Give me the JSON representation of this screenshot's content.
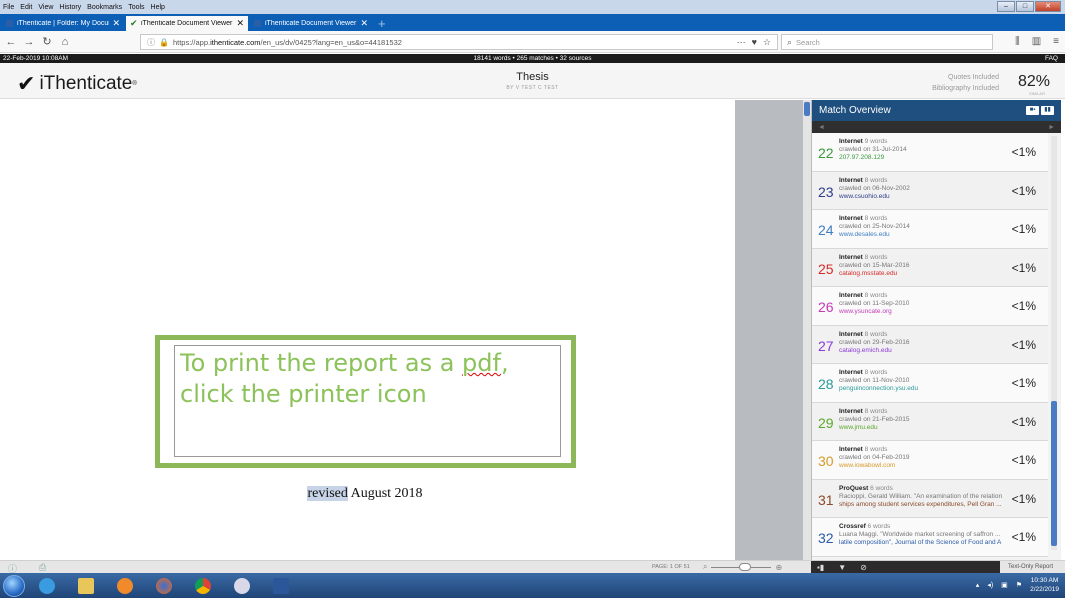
{
  "menubar": {
    "items": [
      "File",
      "Edit",
      "View",
      "History",
      "Bookmarks",
      "Tools",
      "Help"
    ],
    "underline": [
      "F",
      "E",
      "V",
      "s",
      "B",
      "T",
      "H"
    ]
  },
  "tabs": [
    {
      "label": "iThenticate | Folder: My Docum",
      "active": false
    },
    {
      "label": "iThenticate Document Viewer",
      "active": true
    },
    {
      "label": "iThenticate Document Viewer",
      "active": false
    }
  ],
  "url": {
    "prefix": "https://app.",
    "domain": "ithenticate.com",
    "path": "/en_us/dv/0425?lang=en_us&o=44181532"
  },
  "search": {
    "placeholder": "Search"
  },
  "infobar": {
    "date": "22-Feb-2019 10:08AM",
    "stats": "18141 words • 265 matches • 32 sources",
    "faq": "FAQ"
  },
  "header": {
    "logo": "iThenticate",
    "title": "Thesis",
    "subtitle": "BY V TEST C TEST",
    "quotes": "Quotes Included",
    "bibliography": "Bibliography Included",
    "score": "82%",
    "score_label": "SIMILAR"
  },
  "document": {
    "note_line1_a": "To print the report as a ",
    "note_line1_b": "pdf",
    "note_line1_c": ",",
    "note_line2": "click the printer icon",
    "revised_hl": "revised",
    "revised_rest": " August 2018"
  },
  "match_overview": {
    "title": "Match Overview",
    "matches": [
      {
        "num": "22",
        "source": "Internet",
        "words": "9 words",
        "crawled": "crawled on 31-Jul-2014",
        "link": "207.97.208.129",
        "pct": "<1%",
        "color": "#3a9a3a"
      },
      {
        "num": "23",
        "source": "Internet",
        "words": "8 words",
        "crawled": "crawled on 06-Nov-2002",
        "link": "www.csuohio.edu",
        "pct": "<1%",
        "color": "#2e3d8c"
      },
      {
        "num": "24",
        "source": "Internet",
        "words": "8 words",
        "crawled": "crawled on 25-Nov-2014",
        "link": "www.desales.edu",
        "pct": "<1%",
        "color": "#3f7ec4"
      },
      {
        "num": "25",
        "source": "Internet",
        "words": "8 words",
        "crawled": "crawled on 15-Mar-2016",
        "link": "catalog.msstate.edu",
        "pct": "<1%",
        "color": "#d62a2a"
      },
      {
        "num": "26",
        "source": "Internet",
        "words": "8 words",
        "crawled": "crawled on 11-Sep-2010",
        "link": "www.ysuncate.org",
        "pct": "<1%",
        "color": "#c43ab8"
      },
      {
        "num": "27",
        "source": "Internet",
        "words": "8 words",
        "crawled": "crawled on 29-Feb-2016",
        "link": "catalog.emich.edu",
        "pct": "<1%",
        "color": "#8a3ad6"
      },
      {
        "num": "28",
        "source": "Internet",
        "words": "8 words",
        "crawled": "crawled on 11-Nov-2010",
        "link": "penguinconnection.ysu.edu",
        "pct": "<1%",
        "color": "#2a9a9a"
      },
      {
        "num": "29",
        "source": "Internet",
        "words": "8 words",
        "crawled": "crawled on 21-Feb-2015",
        "link": "www.jmu.edu",
        "pct": "<1%",
        "color": "#5aa82a"
      },
      {
        "num": "30",
        "source": "Internet",
        "words": "8 words",
        "crawled": "crawled on 04-Feb-2019",
        "link": "www.iowabowl.com",
        "pct": "<1%",
        "color": "#d69a2a"
      },
      {
        "num": "31",
        "source": "ProQuest",
        "words": "6 words",
        "crawled": "Racioppi, Gerald William. \"An examination of the relation",
        "link": "ships among student services expenditures, Pell Gran ...",
        "pct": "<1%",
        "color": "#8a4a2a"
      },
      {
        "num": "32",
        "source": "Crossref",
        "words": "6 words",
        "crawled": "Luana Maggi. \"Worldwide market screening of saffron ...",
        "link": "latile composition\", Journal of the Science of Food and A",
        "pct": "<1%",
        "color": "#2a5aa8"
      }
    ]
  },
  "bottombar": {
    "page": "PAGE: 1 OF 51",
    "text_only": "Text-Only Report"
  },
  "taskbar": {
    "time": "10:30 AM",
    "date": "2/22/2019"
  },
  "colors": {
    "accent_green": "#8cb85a",
    "header_blue": "#1e4f7e"
  }
}
